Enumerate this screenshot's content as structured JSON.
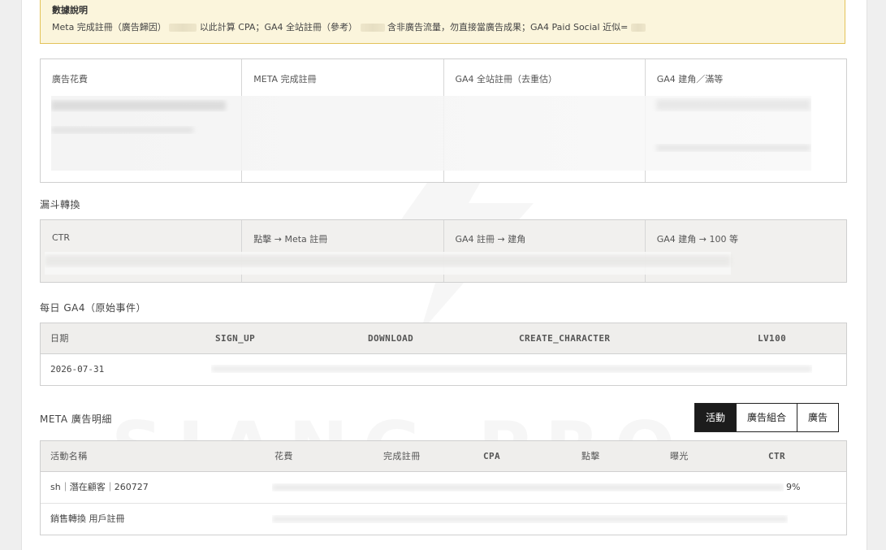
{
  "notice": {
    "title": "數據說明",
    "part1": "Meta 完成註冊（廣告歸因）",
    "part2": "以此計算 CPA；GA4 全站註冊（參考）",
    "part3": "含非廣告流量，勿直接當廣告成果；GA4 Paid Social 近似="
  },
  "kpi": {
    "ad_spend": "廣告花費",
    "meta_reg": "META 完成註冊",
    "ga4_reg": "GA4 全站註冊（去重估）",
    "ga4_char": "GA4 建角／滿等"
  },
  "funnel": {
    "title": "漏斗轉換",
    "ctr": "CTR",
    "click_reg": "點擊 → Meta 註冊",
    "reg_char": "GA4 註冊 → 建角",
    "char_lv": "GA4 建角 → 100 等"
  },
  "daily": {
    "title": "每日 GA4（原始事件）",
    "headers": [
      "日期",
      "SIGN_UP",
      "DOWNLOAD",
      "CREATE_CHARACTER",
      "LV100"
    ],
    "rows": [
      {
        "date": "2026-07-31"
      }
    ]
  },
  "meta": {
    "title": "META 廣告明細",
    "tabs": [
      "活動",
      "廣告組合",
      "廣告"
    ],
    "headers": [
      "活動名稱",
      "花費",
      "完成註冊",
      "CPA",
      "點擊",
      "曝光",
      "CTR"
    ],
    "rows": [
      {
        "name": "sh｜潛在顧客｜260727",
        "ctr": "9%"
      },
      {
        "name": "銷售轉換 用戶註冊",
        "ctr": ""
      }
    ]
  },
  "watermark": "SIANG.PRO",
  "colors": {
    "accent": "#1c1c1c",
    "notice_bg": "#fbf5dc",
    "notice_border": "#e3c35a"
  }
}
